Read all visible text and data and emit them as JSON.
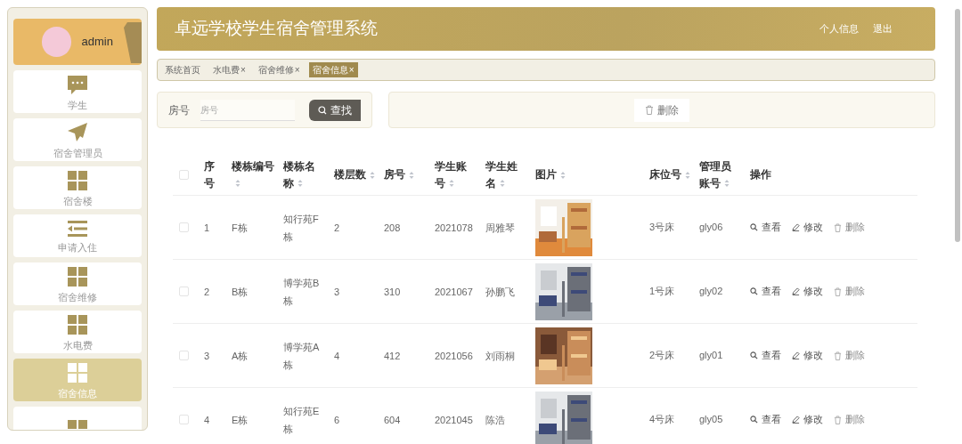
{
  "sidebar": {
    "user": "admin",
    "items": [
      {
        "label": "学生",
        "kind": "chat",
        "selected": false
      },
      {
        "label": "宿舍管理员",
        "kind": "plane",
        "selected": false
      },
      {
        "label": "宿舍楼",
        "kind": "grid",
        "selected": false
      },
      {
        "label": "申请入住",
        "kind": "indent",
        "selected": false
      },
      {
        "label": "宿舍维修",
        "kind": "grid",
        "selected": false
      },
      {
        "label": "水电费",
        "kind": "grid",
        "selected": false
      },
      {
        "label": "宿舍信息",
        "kind": "grid",
        "selected": true
      },
      {
        "kind": "grid",
        "selected": false
      }
    ]
  },
  "header": {
    "title": "卓远学校学生宿舍管理系统",
    "links": [
      "个人信息",
      "退出"
    ]
  },
  "tabs": [
    {
      "label": "系统首页",
      "selected": false
    },
    {
      "label": "水电费",
      "close": "×",
      "selected": false
    },
    {
      "label": "宿舍维修",
      "close": "×",
      "selected": false
    },
    {
      "label": "宿舍信息",
      "close": "×",
      "selected": true
    }
  ],
  "search": {
    "label": "房号",
    "placeholder": "房号",
    "button": "查找"
  },
  "delete_button": "删除",
  "table": {
    "all_checked": false,
    "columns": [
      {
        "label": "序号",
        "sortable": false
      },
      {
        "label": "楼栋编号",
        "sortable": true
      },
      {
        "label": "楼栋名称",
        "sortable": true
      },
      {
        "label": "楼层数",
        "sortable": true
      },
      {
        "label": "房号",
        "sortable": true
      },
      {
        "label": "学生账号",
        "sortable": true
      },
      {
        "label": "学生姓名",
        "sortable": true
      },
      {
        "label": "图片",
        "sortable": true
      },
      {
        "label": "床位号",
        "sortable": true
      },
      {
        "label": "管理员账号",
        "sortable": true
      },
      {
        "label": "操作",
        "sortable": false
      }
    ],
    "rows": [
      {
        "checked": false,
        "cells": [
          "1",
          "F栋",
          "知行苑F栋",
          "2",
          "208",
          "2021078",
          "周雅琴"
        ],
        "bed": "3号床",
        "admin": "gly06",
        "actions": [
          "查看",
          "修改",
          "删除"
        ]
      },
      {
        "checked": false,
        "cells": [
          "2",
          "B栋",
          "博学苑B栋",
          "3",
          "310",
          "2021067",
          "孙鹏飞"
        ],
        "bed": "1号床",
        "admin": "gly02",
        "actions": [
          "查看",
          "修改",
          "删除"
        ]
      },
      {
        "checked": false,
        "cells": [
          "3",
          "A栋",
          "博学苑A栋",
          "4",
          "412",
          "2021056",
          "刘雨桐"
        ],
        "bed": "2号床",
        "admin": "gly01",
        "actions": [
          "查看",
          "修改",
          "删除"
        ]
      },
      {
        "checked": false,
        "cells": [
          "4",
          "E栋",
          "知行苑E栋",
          "6",
          "604",
          "2021045",
          "陈浩"
        ],
        "bed": "4号床",
        "admin": "gly05",
        "actions": [
          "查看",
          "修改",
          "删除"
        ]
      }
    ]
  }
}
